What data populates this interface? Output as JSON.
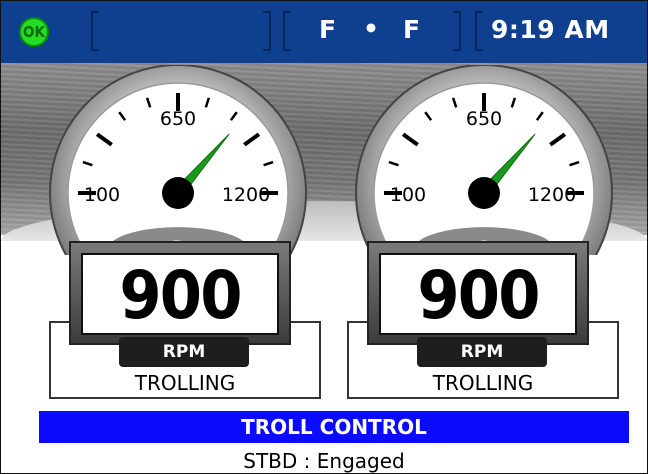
{
  "status_bar": {
    "ok_badge": "OK",
    "fuel_left": "F",
    "fuel_separator": "•",
    "fuel_right": "F",
    "time": "9:19 AM"
  },
  "gauges": [
    {
      "id": "port",
      "tag": "P",
      "tick_labels": {
        "min": "100",
        "mid": "650",
        "max": "1200"
      },
      "scale_min": 100,
      "scale_max": 1200,
      "needle_value": 900,
      "readout": "900",
      "unit_label": "RPM",
      "mode": "TROLLING"
    },
    {
      "id": "starboard",
      "tag": "S",
      "tick_labels": {
        "min": "100",
        "mid": "650",
        "max": "1200"
      },
      "scale_min": 100,
      "scale_max": 1200,
      "needle_value": 900,
      "readout": "900",
      "unit_label": "RPM",
      "mode": "TROLLING"
    }
  ],
  "troll_control": {
    "title": "TROLL CONTROL"
  },
  "status_message": "STBD : Engaged",
  "colors": {
    "status_bar": "#0f3f8f",
    "ok_badge": "#22dd22",
    "needle": "#1a9a1a",
    "troll_bar": "#0b0bff"
  },
  "icons": {
    "needle": "gauge-needle-icon"
  }
}
